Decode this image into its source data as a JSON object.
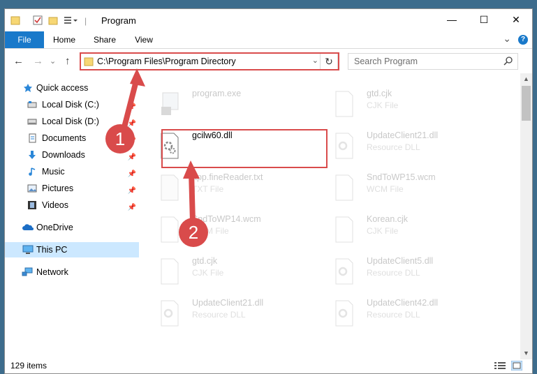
{
  "window": {
    "title": "Program",
    "controls": {
      "minimize": "—",
      "maximize": "☐",
      "close": "✕"
    }
  },
  "ribbon": {
    "tabs": [
      "File",
      "Home",
      "Share",
      "View"
    ],
    "collapse_glyph": "⌄",
    "help_glyph": "?"
  },
  "address": {
    "path": "C:\\Program Files\\Program Directory",
    "dropdown_glyph": "⌄",
    "refresh_glyph": "↻"
  },
  "search": {
    "placeholder": "Search Program"
  },
  "nav": {
    "back": "←",
    "forward": "→",
    "recent": "⌄",
    "up": "↑"
  },
  "sidebar": {
    "items": [
      {
        "label": "Quick access"
      },
      {
        "label": "Local Disk (C:)"
      },
      {
        "label": "Local Disk (D:)"
      },
      {
        "label": "Documents"
      },
      {
        "label": "Downloads"
      },
      {
        "label": "Music"
      },
      {
        "label": "Pictures"
      },
      {
        "label": "Videos"
      },
      {
        "label": "OneDrive"
      },
      {
        "label": "This PC"
      },
      {
        "label": "Network"
      }
    ]
  },
  "files": [
    {
      "name": "program.exe",
      "type": ""
    },
    {
      "name": "gtd.cjk",
      "type": "CJK File"
    },
    {
      "name": "gcilw60.dll",
      "type": ""
    },
    {
      "name": "UpdateClient21.dll",
      "type": "Resource DLL"
    },
    {
      "name": "app.fineReader.txt",
      "type": "TXT File"
    },
    {
      "name": "SndToWP15.wcm",
      "type": "WCM File"
    },
    {
      "name": "SndToWP14.wcm",
      "type": "WCM File"
    },
    {
      "name": "Korean.cjk",
      "type": "CJK File"
    },
    {
      "name": "gtd.cjk",
      "type": "CJK File"
    },
    {
      "name": "UpdateClient5.dll",
      "type": "Resource DLL"
    },
    {
      "name": "UpdateClient21.dll",
      "type": "Resource DLL"
    },
    {
      "name": "UpdateClient42.dll",
      "type": "Resource DLL"
    }
  ],
  "status": {
    "count": "129 items"
  },
  "callouts": [
    "1",
    "2"
  ],
  "colors": {
    "accent": "#1979ca",
    "highlight": "#d94b4b",
    "selected": "#cce8ff"
  }
}
